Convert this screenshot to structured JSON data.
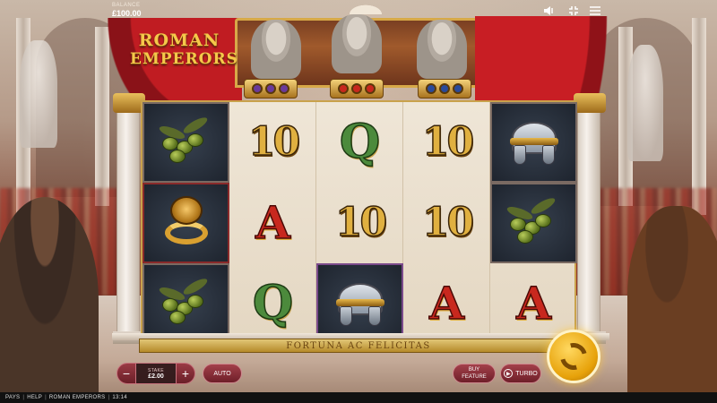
{
  "header": {
    "balance_label": "BALANCE",
    "balance_value": "£100.00",
    "icons": [
      "speaker-icon",
      "fullscreen-icon",
      "menu-icon"
    ]
  },
  "logo": {
    "line1": "ROMAN",
    "line2": "EMPERORS"
  },
  "gems": {
    "left": "#6a3a9a",
    "center": "#c8281e",
    "right": "#2a4a9a"
  },
  "reels": [
    [
      "olives",
      "lion-ring",
      "olives"
    ],
    [
      "10",
      "A",
      "Q"
    ],
    [
      "Q",
      "10",
      "helmet"
    ],
    [
      "10",
      "10",
      "A"
    ],
    [
      "helmet",
      "olives",
      "A"
    ]
  ],
  "motto": "FORTUNA AC FELICITAS",
  "controls": {
    "minus": "−",
    "plus": "+",
    "stake_label": "STAKE",
    "stake_value": "£2.00",
    "auto": "AUTO",
    "buy_line1": "BUY",
    "buy_line2": "FEATURE",
    "turbo": "TURBO"
  },
  "footer": {
    "pays": "PAYS",
    "help": "HELP",
    "game_name": "ROMAN EMPERORS",
    "time": "13:14"
  },
  "colors": {
    "accent_gold": "#e7a20a",
    "button_red": "#8a2a34",
    "drape_red": "#c01c22"
  }
}
